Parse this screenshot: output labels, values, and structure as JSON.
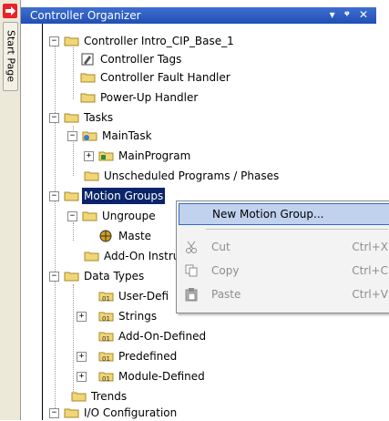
{
  "start_page": {
    "label": "Start Page"
  },
  "panel": {
    "title": "Controller Organizer",
    "pin_icon": "pin-icon",
    "close_icon": "close-icon"
  },
  "tree": {
    "controller": "Controller Intro_CIP_Base_1",
    "controller_tags": "Controller Tags",
    "fault_handler": "Controller Fault Handler",
    "powerup_handler": "Power-Up Handler",
    "tasks": "Tasks",
    "main_task": "MainTask",
    "main_program": "MainProgram",
    "unscheduled": "Unscheduled Programs / Phases",
    "motion_groups": "Motion Groups",
    "ungrouped": "Ungroupe",
    "master": "Maste",
    "addon_instr": "Add-On Instru",
    "data_types": "Data Types",
    "user_defined": "User-Defi",
    "strings": "Strings",
    "addon_defined": "Add-On-Defined",
    "predefined": "Predefined",
    "module_defined": "Module-Defined",
    "trends": "Trends",
    "io_config": "I/O Configuration"
  },
  "context_menu": {
    "new_motion_group": "New Motion Group...",
    "cut": "Cut",
    "cut_shortcut": "Ctrl+X",
    "copy": "Copy",
    "copy_shortcut": "Ctrl+C",
    "paste": "Paste",
    "paste_shortcut": "Ctrl+V"
  },
  "colors": {
    "titlebar": "#2a5bc2",
    "selection": "#0a246a",
    "menu_highlight": "#c1d2ee",
    "folder": "#f0d676"
  }
}
